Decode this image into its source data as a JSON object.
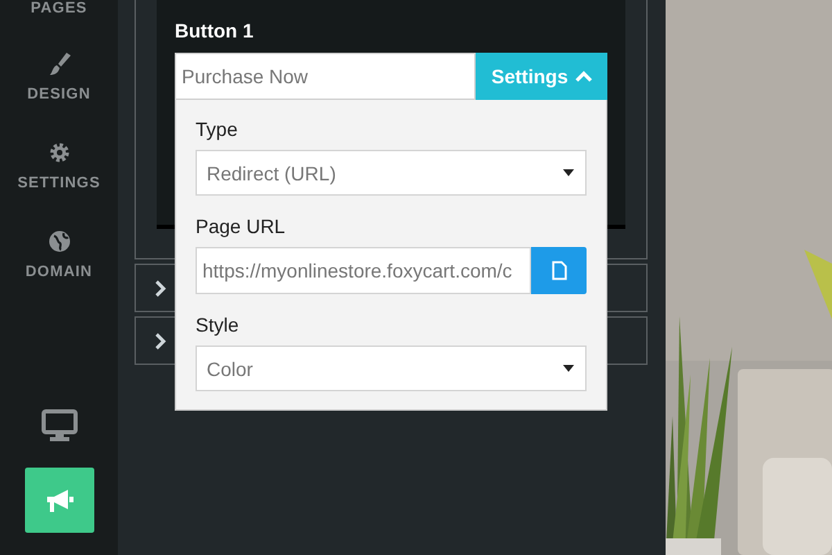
{
  "sidebar": {
    "items": [
      {
        "label": "PAGES"
      },
      {
        "label": "DESIGN"
      },
      {
        "label": "SETTINGS"
      },
      {
        "label": "DOMAIN"
      }
    ]
  },
  "editor": {
    "section_title": "Button 1",
    "button_text": {
      "value": "Purchase Now"
    },
    "settings_button": {
      "label": "Settings",
      "expanded": true
    },
    "settings": {
      "type": {
        "label": "Type",
        "value": "Redirect (URL)"
      },
      "page_url": {
        "label": "Page URL",
        "value": "https://myonlinestore.foxycart.com/c"
      },
      "style": {
        "label": "Style",
        "value": "Color"
      }
    },
    "collapsed_sections": [
      {
        "expanded": false
      },
      {
        "expanded": false
      }
    ]
  }
}
